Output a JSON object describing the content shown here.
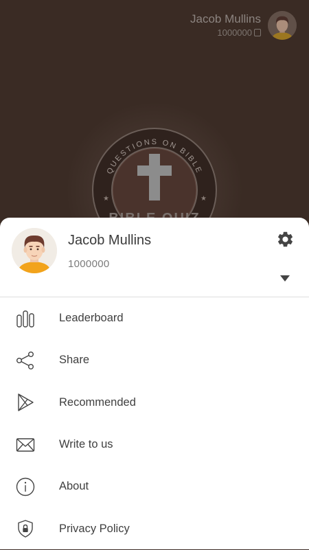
{
  "header": {
    "user_name": "Jacob Mullins",
    "coins": "1000000"
  },
  "logo": {
    "arc_text": "QUESTIONS ON BIBLE",
    "banner_text": "BIBLE QUIZ"
  },
  "drawer": {
    "user_name": "Jacob Mullins",
    "score": "1000000",
    "menu": [
      {
        "label": "Leaderboard",
        "icon": "leaderboard-icon"
      },
      {
        "label": "Share",
        "icon": "share-icon"
      },
      {
        "label": "Recommended",
        "icon": "play-store-icon"
      },
      {
        "label": "Write to us",
        "icon": "mail-icon"
      },
      {
        "label": "About",
        "icon": "info-icon"
      },
      {
        "label": "Privacy Policy",
        "icon": "privacy-shield-icon"
      }
    ]
  },
  "colors": {
    "background": "#3a2b24",
    "sheet": "#ffffff",
    "icon": "#444444",
    "gear": "#444444"
  }
}
